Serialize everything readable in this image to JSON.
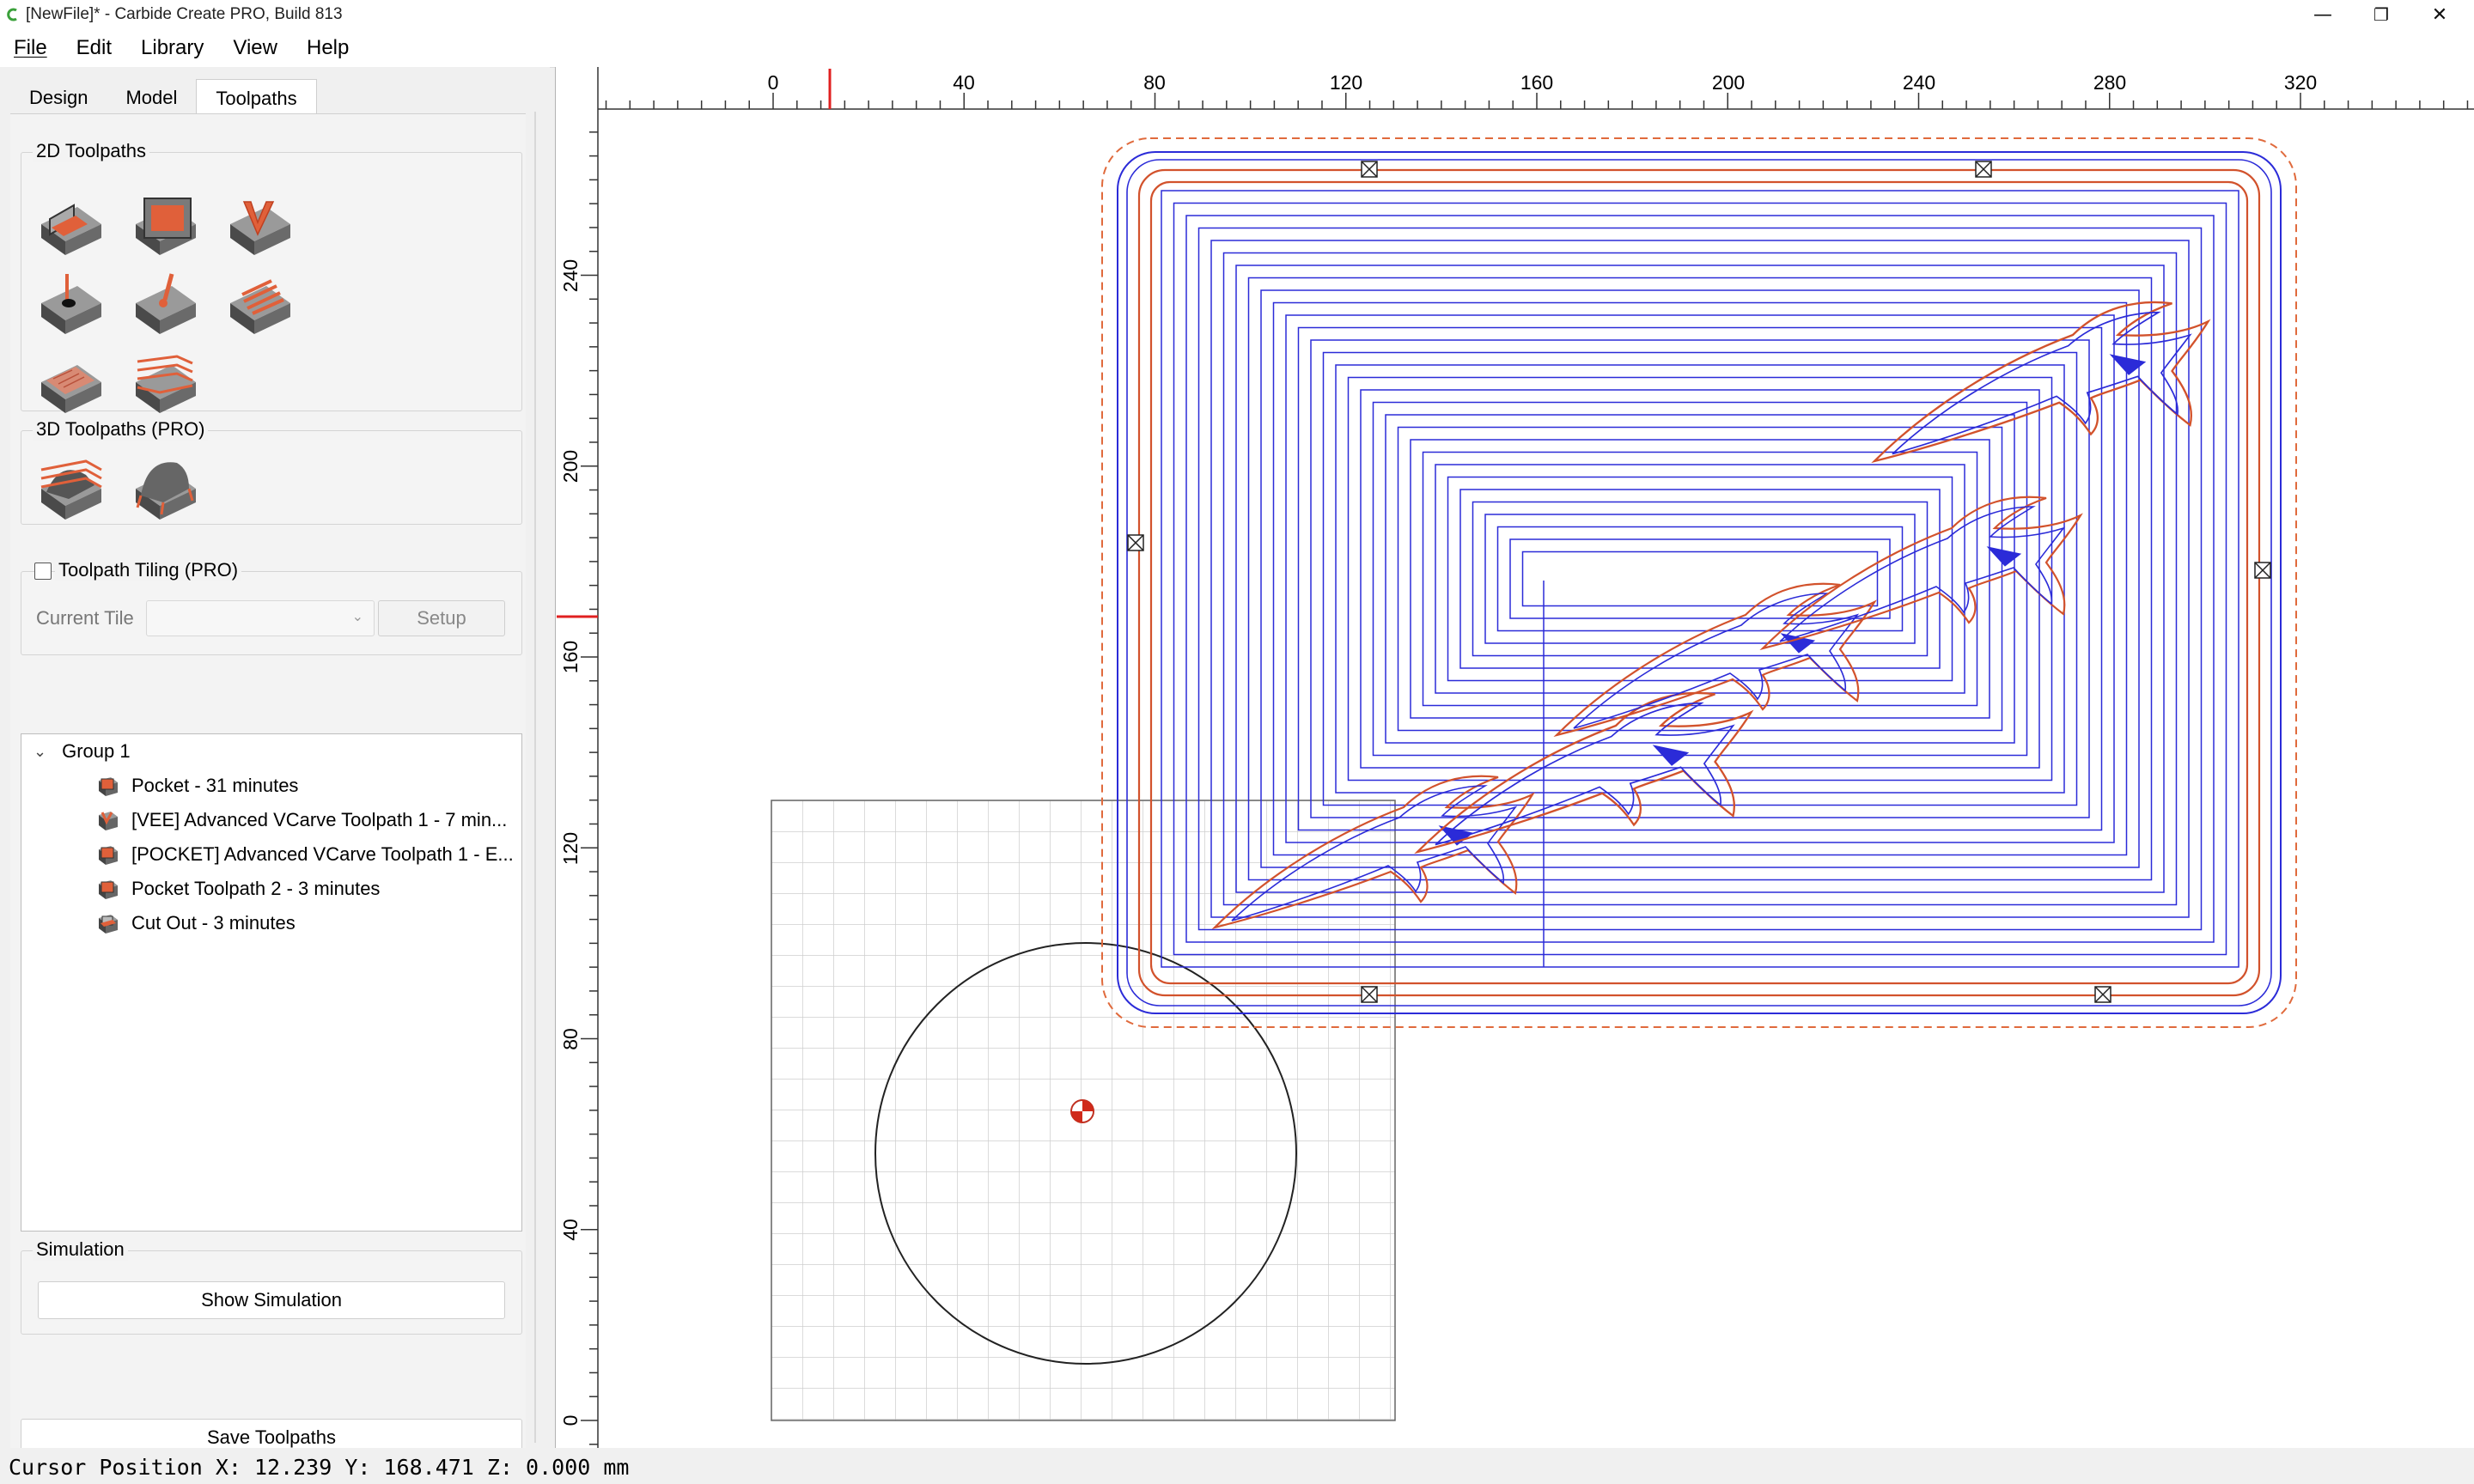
{
  "window": {
    "title": "[NewFile]* - Carbide Create PRO, Build 813",
    "minimize_glyph": "—",
    "maximize_glyph": "❐",
    "close_glyph": "✕"
  },
  "menu": [
    "File",
    "Edit",
    "Library",
    "View",
    "Help"
  ],
  "tabs": [
    "Design",
    "Model",
    "Toolpaths"
  ],
  "toolpaths_2d": {
    "title": "2D Toolpaths",
    "tools": [
      "contour-icon",
      "pocket-icon",
      "vcarve-icon",
      "drill-icon",
      "engrave-icon",
      "texture-icon",
      "hatch-icon",
      "layer-icon"
    ]
  },
  "toolpaths_3d": {
    "title": "3D Toolpaths (PRO)",
    "tools": [
      "3d-rough-icon",
      "3d-finish-icon"
    ]
  },
  "tiling": {
    "label": "Toolpath Tiling (PRO)",
    "current_tile_label": "Current Tile",
    "current_tile_value": "",
    "setup_label": "Setup"
  },
  "tree": {
    "group_label": "Group 1",
    "items": [
      "Pocket - 31 minutes",
      "[VEE] Advanced VCarve Toolpath 1 - 7 min...",
      "[POCKET] Advanced VCarve Toolpath 1 - E...",
      "Pocket Toolpath 2 - 3 minutes",
      "Cut Out - 3 minutes"
    ]
  },
  "simulation": {
    "title": "Simulation",
    "show_label": "Show Simulation"
  },
  "save_label": "Save Toolpaths",
  "status": {
    "cursor": "Cursor Position X: 12.239 Y: 168.471 Z: 0.000 mm"
  },
  "ruler": {
    "x_ticks": [
      "0",
      "40",
      "80",
      "120",
      "160",
      "200",
      "240",
      "280",
      "320"
    ],
    "y_ticks": [
      "0",
      "40",
      "80",
      "120",
      "160",
      "200",
      "240"
    ]
  },
  "colors": {
    "toolpath_blue": "#2b2bd8",
    "toolpath_red": "#d2522c",
    "tool_orange": "#e0603a"
  }
}
